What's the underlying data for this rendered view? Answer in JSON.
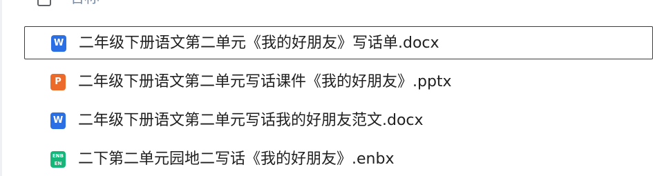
{
  "header": {
    "name_column_label": "名称"
  },
  "files": [
    {
      "name": "二年级下册语文第二单元《我的好朋友》写话单.docx",
      "type": "docx",
      "icon_letter": "W",
      "selected": true
    },
    {
      "name": "二年级下册语文第二单元写话课件《我的好朋友》.pptx",
      "type": "pptx",
      "icon_letter": "P",
      "selected": false
    },
    {
      "name": "二年级下册语文第二单元写话我的好朋友范文.docx",
      "type": "docx",
      "icon_letter": "W",
      "selected": false
    },
    {
      "name": "二下第二单元园地二写话《我的好朋友》.enbx",
      "type": "enbx",
      "icon_letter_top": "ENB",
      "icon_letter_bottom": "EN",
      "selected": false
    }
  ],
  "colors": {
    "docx_icon": "#2b6fe4",
    "pptx_icon": "#ec6a2a",
    "enbx_icon": "#16b67a",
    "selected_border": "#3c3c3c",
    "header_text": "#7a8ca8"
  }
}
